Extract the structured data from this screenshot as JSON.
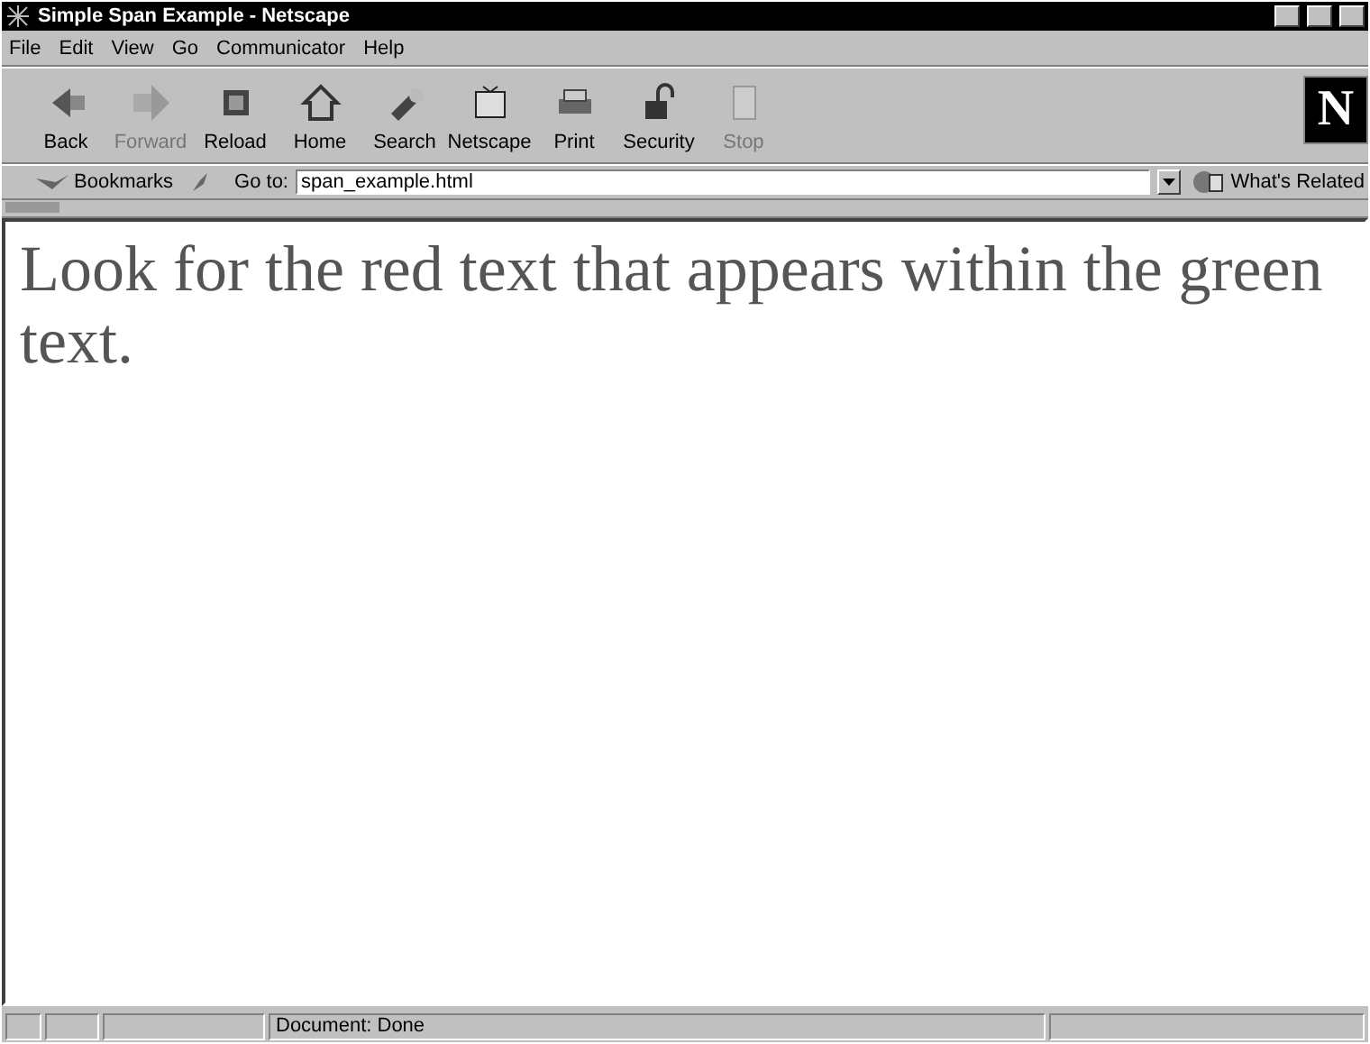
{
  "window": {
    "title": "Simple Span Example - Netscape"
  },
  "menu": [
    "File",
    "Edit",
    "View",
    "Go",
    "Communicator",
    "Help"
  ],
  "toolbar": [
    {
      "label": "Back",
      "disabled": false
    },
    {
      "label": "Forward",
      "disabled": true
    },
    {
      "label": "Reload",
      "disabled": false
    },
    {
      "label": "Home",
      "disabled": false
    },
    {
      "label": "Search",
      "disabled": false
    },
    {
      "label": "Netscape",
      "disabled": false
    },
    {
      "label": "Print",
      "disabled": false
    },
    {
      "label": "Security",
      "disabled": false
    },
    {
      "label": "Stop",
      "disabled": true
    }
  ],
  "logo": "N",
  "location_bar": {
    "bookmarks": "Bookmarks",
    "goto_label": "Go to:",
    "url": "span_example.html",
    "related": "What's Related"
  },
  "content": {
    "text": "Look for the red text that appears within the green text."
  },
  "status_bar": {
    "message": "Document: Done"
  }
}
